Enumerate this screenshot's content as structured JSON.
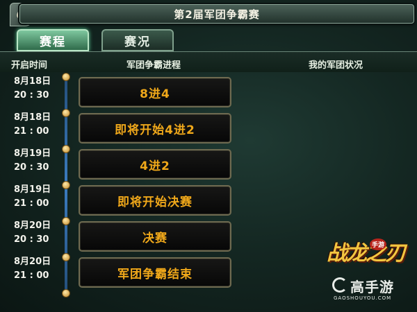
{
  "window": {
    "title": "第2届军团争霸赛"
  },
  "tabs": [
    {
      "label": "赛程",
      "active": true
    },
    {
      "label": "赛况",
      "active": false
    }
  ],
  "table_headers": {
    "time": "开启时间",
    "progress": "军团争霸进程",
    "status": "我的军团状况"
  },
  "schedule": [
    {
      "date": "8月18日",
      "time": "20 : 30",
      "stage": "8进4"
    },
    {
      "date": "8月18日",
      "time": "21 : 00",
      "stage": "即将开始4进2"
    },
    {
      "date": "8月19日",
      "time": "20 : 30",
      "stage": "4进2"
    },
    {
      "date": "8月19日",
      "time": "21 : 00",
      "stage": "即将开始决赛"
    },
    {
      "date": "8月20日",
      "time": "20 : 30",
      "stage": "决赛"
    },
    {
      "date": "8月20日",
      "time": "21 : 00",
      "stage": "军团争霸结束"
    }
  ],
  "branding": {
    "corner_logo": "G",
    "game_logo": "战龙之刃",
    "game_logo_badge": "手游",
    "watermark": "高手游",
    "watermark_url": "GAOSHOUYOU.COM"
  },
  "colors": {
    "accent_active_tab": "#7ec79f",
    "stage_text": "#f0a81a",
    "timeline": "#3b7cc0"
  }
}
